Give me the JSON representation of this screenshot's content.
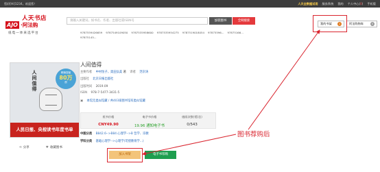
{
  "topbar": {
    "welcome": "您好[Hi]1234，欢迎您！",
    "trial_link": "人天全数据试用",
    "system": "服务系统",
    "menu_short": "我的",
    "personal_center": "个人中心",
    "cart_count": "0",
    "mobile": "手机版"
  },
  "logo": {
    "line1": "人天书店",
    "brand_latin": "AJO",
    "brand_cn": "·阿法购",
    "slogan": "纸电一体采选平台"
  },
  "search": {
    "placeholder": "请输入关键词，如书名、作者、出版社或ISBN号",
    "btn_library": "加装图书",
    "btn_network": "全网搜索",
    "isbn_history": [
      "9787559426659",
      "9787549109050",
      "9787535958600",
      "9787535954275",
      "9787519018054",
      "97875596...",
      "97875166...",
      "97875145..."
    ]
  },
  "header_buttons": {
    "my_shelf_label": "我的书架",
    "my_shelf_count": "1",
    "ajo_shelf_label": "阿法购物车",
    "ajo_shelf_count": "0"
  },
  "book": {
    "cover_title": "人间值得",
    "cover_sticker_top": "畅销突破",
    "cover_sticker_value": "80万",
    "cover_sticker_bottom": "册",
    "cover_banner": "人民日报、央视读书年度书单",
    "title": "人间值得",
    "author_label": "主要作者",
    "authors": "中村恒子，奥田弘美",
    "author_suffix": "著",
    "translator_label": "译者",
    "translator": "范宗涛",
    "publisher_label": "出版社",
    "publisher": "北京日报出版社",
    "date_label": "出版时间",
    "date": "2019.09",
    "isbn_label": "ISBN",
    "isbn": "978-7-5477-3431-5",
    "stock_note": "本馆无类似馆藏 / 共403家图书馆有类似馆藏",
    "price_cols": [
      {
        "label": "纸书价格",
        "value": "CNY49.90"
      },
      {
        "label": "电子书价格",
        "value": "19.96 通知电子书"
      },
      {
        "label": "借阅次数(馆/总)",
        "value": "0/543"
      }
    ],
    "cls_label": "中图分类",
    "cls_value": "B842.6-->B84 心理学-->B 哲学、宗教",
    "subject_label": "学科分类",
    "subject_value": "基础心理学-->心理学(可授教育学...)",
    "btn_add_shelf": "加入书架",
    "btn_ebook": "电子书荐购",
    "share": "分享",
    "favorite": "收藏图书"
  },
  "annotation": {
    "text": "图书荐购后",
    "color": "#d9232d"
  },
  "colors": {
    "topbar_bg": "#3d3d3d",
    "brand_red": "#d5101b",
    "search_red": "#e4393c",
    "shelf_badge": "#e07a1f",
    "ebook_green": "#1e9e4f"
  }
}
